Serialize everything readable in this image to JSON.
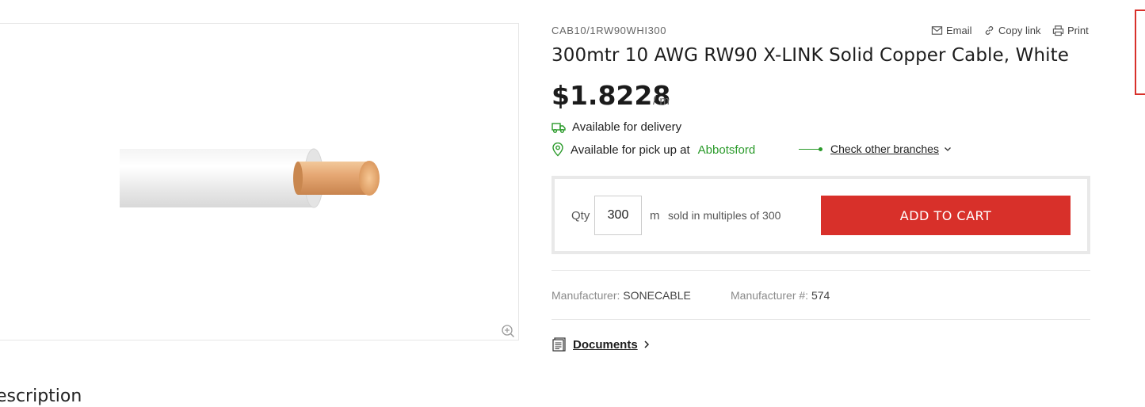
{
  "product": {
    "sku": "CAB10/1RW90WHI300",
    "title": "300mtr 10 AWG RW90 X-LINK Solid Copper Cable, White",
    "price": "$1.8228",
    "price_unit": "/ m",
    "image_alt": "White cable with copper conductor"
  },
  "share": {
    "email_label": "Email",
    "copy_link_label": "Copy link",
    "print_label": "Print"
  },
  "availability": {
    "delivery_text": "Available for delivery",
    "pickup_text": "Available for pick up at",
    "pickup_branch": "Abbotsford",
    "check_branches_label": "Check other branches"
  },
  "cart": {
    "qty_label": "Qty",
    "qty_value": "300",
    "qty_unit": "m",
    "multiples_text": "sold in multiples of 300",
    "add_button_label": "ADD TO CART"
  },
  "meta": {
    "manufacturer_label": "Manufacturer:",
    "manufacturer_value": "SONECABLE",
    "manufacturer_num_label": "Manufacturer #:",
    "manufacturer_num_value": "574"
  },
  "documents_label": "Documents",
  "description_heading": "Description",
  "colors": {
    "accent": "#d8302a",
    "available_green": "#2a9a2a"
  },
  "icons": [
    "zoom-icon",
    "email-icon",
    "link-icon",
    "print-icon",
    "truck-icon",
    "location-pin-icon",
    "chevron-down-icon",
    "documents-icon",
    "chevron-right-icon"
  ]
}
